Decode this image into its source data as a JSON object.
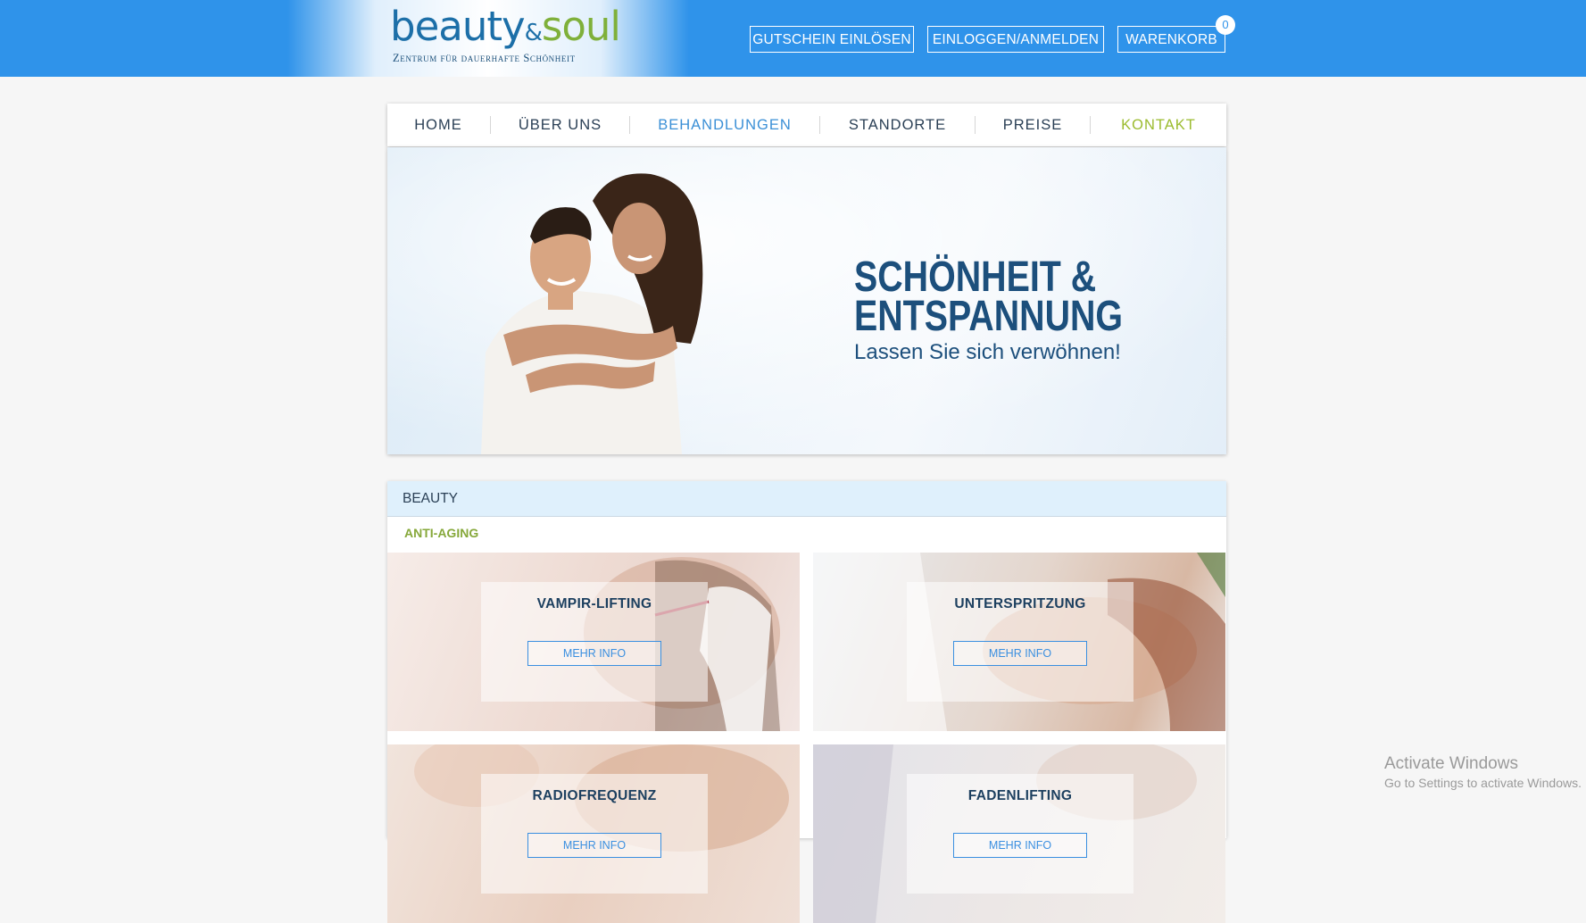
{
  "header": {
    "logo": {
      "brand_left": "beauty",
      "brand_amp": "&",
      "brand_right": "soul",
      "tagline": "Zentrum für dauerhafte Schönheit"
    },
    "buttons": [
      {
        "label": "GUTSCHEIN EINLÖSEN"
      },
      {
        "label": "EINLOGGEN/ANMELDEN"
      },
      {
        "label": "WARENKORB"
      }
    ],
    "cart_count": "0"
  },
  "nav": {
    "items": [
      {
        "label": "HOME",
        "color": "#2a3f55"
      },
      {
        "label": "ÜBER UNS",
        "color": "#2a3f55"
      },
      {
        "label": "BEHANDLUNGEN",
        "color": "#3a8fd6"
      },
      {
        "label": "STANDORTE",
        "color": "#2a3f55"
      },
      {
        "label": "PREISE",
        "color": "#2a3f55"
      },
      {
        "label": "KONTAKT",
        "color": "#9bbb2e"
      }
    ]
  },
  "hero": {
    "line1": "SCHÖNHEIT &",
    "line2": "ENTSPANNUNG",
    "subtitle": "Lassen Sie sich verwöhnen!"
  },
  "section": {
    "title": "BEAUTY",
    "subcategory": "ANTI-AGING",
    "cards": [
      {
        "title": "VAMPIR-LIFTING",
        "button": "MEHR INFO"
      },
      {
        "title": "UNTERSPRITZUNG",
        "button": "MEHR INFO"
      },
      {
        "title": "RADIOFREQUENZ",
        "button": "MEHR INFO"
      },
      {
        "title": "FADENLIFTING",
        "button": "MEHR INFO"
      }
    ]
  },
  "watermark": {
    "title": "Activate Windows",
    "subtitle": "Go to Settings to activate Windows."
  },
  "colors": {
    "topbar": "#2f93ea",
    "brand_blue": "#1c6fa8",
    "brand_green": "#7fb03a",
    "active_nav": "#3a8fd6",
    "accent_nav": "#9bbb2e",
    "section_header": "#dff0fc"
  }
}
